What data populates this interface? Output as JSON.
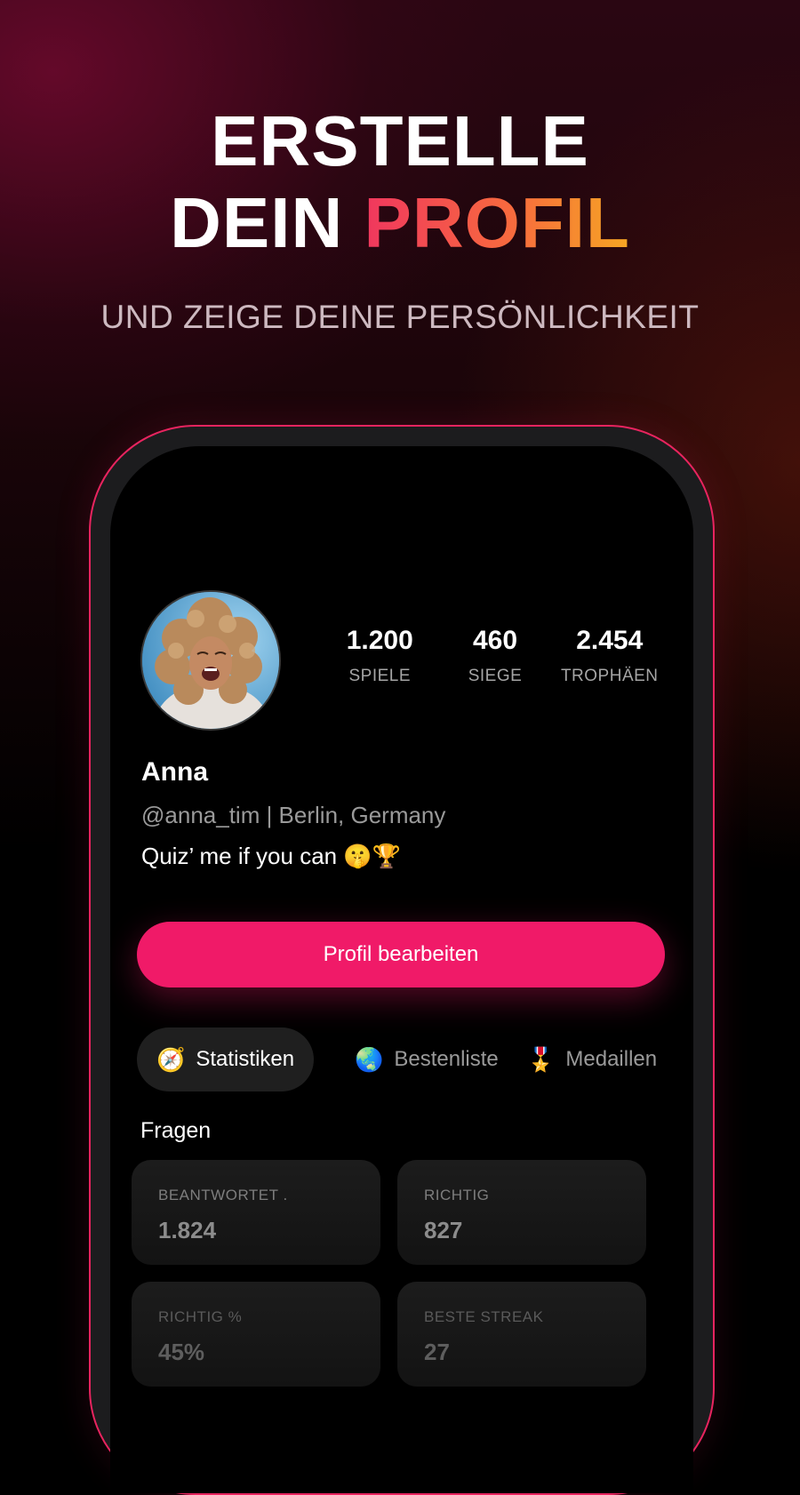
{
  "hero": {
    "line1": "ERSTELLE",
    "line2_prefix": "DEIN ",
    "line2_accent": "PROFIL",
    "subtitle": "UND ZEIGE DEINE PERSÖNLICHKEIT"
  },
  "profile": {
    "stats": [
      {
        "value": "1.200",
        "label": "SPIELE"
      },
      {
        "value": "460",
        "label": "SIEGE"
      },
      {
        "value": "2.454",
        "label": "TROPHÄEN"
      }
    ],
    "name": "Anna",
    "handle_location": "@anna_tim | Berlin, Germany",
    "bio": "Quiz’ me if you can 🤫🏆",
    "edit_button": "Profil bearbeiten"
  },
  "tabs": [
    {
      "emoji": "🧭",
      "label": "Statistiken",
      "active": true
    },
    {
      "emoji": "🌏",
      "label": "Bestenliste",
      "active": false
    },
    {
      "emoji": "🎖️",
      "label": "Medaillen",
      "active": false
    }
  ],
  "questions": {
    "title": "Fragen",
    "cards": [
      {
        "label": "BEANTWORTET  .",
        "value": "1.824"
      },
      {
        "label": "RICHTIG",
        "value": "827"
      },
      {
        "label": "RICHTIG %",
        "value": "45%"
      },
      {
        "label": "BESTE STREAK",
        "value": "27"
      }
    ]
  },
  "colors": {
    "accent": "#f01a68",
    "gradient_start": "#f0375e",
    "gradient_end": "#f6a623",
    "phone_border": "#e8245f"
  }
}
